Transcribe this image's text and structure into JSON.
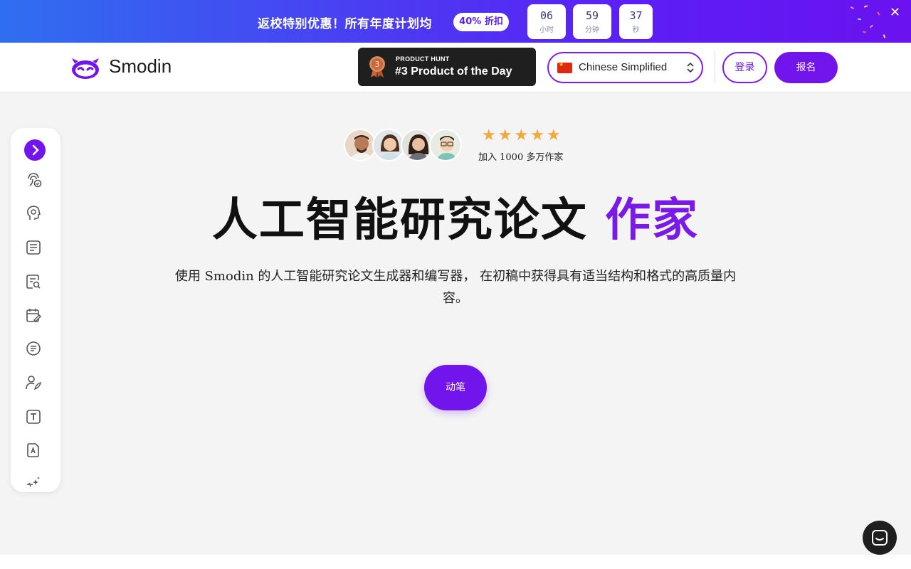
{
  "promo": {
    "text": "返校特别优惠！所有年度计划均",
    "badge": "40% 折扣",
    "timers": [
      {
        "value": "06",
        "unit": "小时"
      },
      {
        "value": "59",
        "unit": "分钟"
      },
      {
        "value": "37",
        "unit": "秒"
      }
    ],
    "close_icon": "close-icon"
  },
  "header": {
    "logo_text": "Smodin",
    "product_hunt": {
      "small": "PRODUCT HUNT",
      "big": "#3 Product of the Day",
      "rank": "3"
    },
    "language": "Chinese Simplified",
    "login": "登录",
    "signup": "报名"
  },
  "sidebar": {
    "icons": [
      "chevron-right-icon",
      "fingerprint-check-icon",
      "brain-head-icon",
      "document-lines-icon",
      "document-search-icon",
      "calendar-edit-icon",
      "circle-lines-icon",
      "user-quill-icon",
      "text-box-icon",
      "document-ai-icon",
      "sparkles-icon"
    ]
  },
  "hero": {
    "stars": "★★★★★",
    "join_text": "加入 1000 多万作家",
    "title_main": "人工智能研究论文",
    "title_accent": "作家",
    "subtitle": "使用 Smodin 的人工智能研究论文生成器和编写器， 在初稿中获得具有适当结构和格式的高质量内容。",
    "cta": "动笔"
  },
  "colors": {
    "brand": "#7215ec",
    "accent_text": "#7a1ae6",
    "star": "#f2a93b"
  }
}
